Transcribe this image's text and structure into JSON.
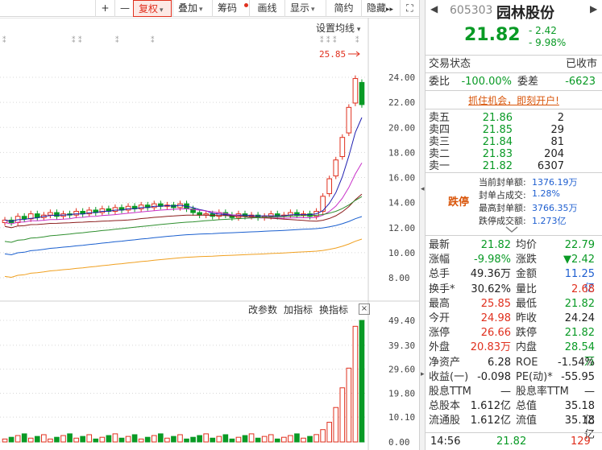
{
  "toolbar": {
    "plus": "+",
    "minus": "—",
    "fuquan": "复权",
    "diejia": "叠加",
    "chouma": "筹码",
    "huaxian": "画线",
    "xianshi": "显示",
    "jianyue": "简约",
    "yincang": "隐藏",
    "more": "▸▸",
    "fullscreen": "⛶"
  },
  "chart": {
    "ma_setting": "设置均线",
    "high_label": "25.85",
    "price_axis": [
      "24.00",
      "22.00",
      "20.00",
      "18.00",
      "16.00",
      "14.00",
      "12.00",
      "10.00",
      "8.00"
    ],
    "indicator_buttons": [
      "改参数",
      "加指标",
      "换指标"
    ],
    "indicator_close": "×",
    "volume_axis": [
      "49.40",
      "39.30",
      "29.60",
      "19.80",
      "10.10",
      "0.00"
    ]
  },
  "chart_data": {
    "type": "candlestick",
    "price_range": [
      8,
      25.85
    ],
    "volume_range": [
      0,
      49.4
    ],
    "closes": [
      12.6,
      12.4,
      12.9,
      12.7,
      13.1,
      12.8,
      13.0,
      13.2,
      12.9,
      13.1,
      13.0,
      13.3,
      13.1,
      13.4,
      13.2,
      13.5,
      13.3,
      13.6,
      13.4,
      13.7,
      13.5,
      13.8,
      13.6,
      13.9,
      13.7,
      13.8,
      13.6,
      13.9,
      13.5,
      13.2,
      13.0,
      13.1,
      12.9,
      13.2,
      13.0,
      12.8,
      13.1,
      12.9,
      13.0,
      12.8,
      12.9,
      13.1,
      12.9,
      13.0,
      13.2,
      13.0,
      13.1,
      12.9,
      13.3,
      14.5,
      15.9,
      17.4,
      19.2,
      21.6,
      23.9,
      21.82
    ],
    "ma_colors": [
      "#1f1fb0",
      "#c830c8",
      "#8b1c1c",
      "#2f8f2f",
      "#1a5fcf",
      "#f0a020"
    ],
    "volume_bar_color_up": "#e0301e",
    "volume_bar_color_down": "#099a25"
  },
  "stock": {
    "code": "605303",
    "name": "园林股份",
    "price": "21.82",
    "change": "- 2.42",
    "change_pct": "- 9.98%"
  },
  "status": {
    "label": "交易状态",
    "value": "已收市"
  },
  "webi": {
    "label1": "委比",
    "value1": "-100.00%",
    "label2": "委差",
    "value2": "-6623"
  },
  "promo": "抓住机会，即刻开户!",
  "order_book": [
    {
      "label": "卖五",
      "price": "21.86",
      "vol": "2"
    },
    {
      "label": "卖四",
      "price": "21.85",
      "vol": "29"
    },
    {
      "label": "卖三",
      "price": "21.84",
      "vol": "81"
    },
    {
      "label": "卖二",
      "price": "21.83",
      "vol": "204"
    },
    {
      "label": "卖一",
      "price": "21.82",
      "vol": "6307"
    }
  ],
  "seal": {
    "tag": "跌停",
    "items": [
      {
        "label": "当前封单额:",
        "value": "1376.19万"
      },
      {
        "label": "封单占成交:",
        "value": "1.28%"
      },
      {
        "label": "最高封单额:",
        "value": "3766.35万"
      },
      {
        "label": "跌停成交额:",
        "value": "1.273亿"
      }
    ]
  },
  "stats": [
    {
      "l1": "最新",
      "v1": "21.82",
      "c1": "green",
      "l2": "均价",
      "v2": "22.79",
      "c2": "green"
    },
    {
      "l1": "涨幅",
      "v1": "-9.98%",
      "c1": "green",
      "l2": "涨跌",
      "v2": "▼2.42",
      "c2": "green"
    },
    {
      "l1": "总手",
      "v1": "49.36万",
      "c1": "dark",
      "l2": "金额",
      "v2": "11.25亿",
      "c2": "blue"
    },
    {
      "l1": "换手*",
      "v1": "30.62%",
      "c1": "dark",
      "l2": "量比",
      "v2": "2.68",
      "c2": "red"
    },
    {
      "l1": "最高",
      "v1": "25.85",
      "c1": "red",
      "l2": "最低",
      "v2": "21.82",
      "c2": "green"
    },
    {
      "l1": "今开",
      "v1": "24.98",
      "c1": "red",
      "l2": "昨收",
      "v2": "24.24",
      "c2": "dark"
    },
    {
      "l1": "涨停",
      "v1": "26.66",
      "c1": "red",
      "l2": "跌停",
      "v2": "21.82",
      "c2": "green"
    },
    {
      "l1": "外盘",
      "v1": "20.83万",
      "c1": "red",
      "l2": "内盘",
      "v2": "28.54万",
      "c2": "green"
    },
    {
      "l1": "净资产",
      "v1": "6.28",
      "c1": "dark",
      "l2": "ROE",
      "v2": "-1.54%",
      "c2": "dark"
    },
    {
      "l1": "收益(一)",
      "v1": "-0.098",
      "c1": "dark",
      "l2": "PE(动)*",
      "v2": "-55.95",
      "c2": "dark"
    },
    {
      "l1": "股息TTM",
      "v1": "—",
      "c1": "dark",
      "l2": "股息率TTM",
      "v2": "—",
      "c2": "dark"
    },
    {
      "l1": "总股本",
      "v1": "1.612亿",
      "c1": "dark",
      "l2": "总值",
      "v2": "35.18亿",
      "c2": "dark"
    },
    {
      "l1": "流通股",
      "v1": "1.612亿",
      "c1": "dark",
      "l2": "流值",
      "v2": "35.18亿",
      "c2": "dark"
    }
  ],
  "footer": {
    "time": "14:56",
    "price": "21.82",
    "vol": "129"
  }
}
